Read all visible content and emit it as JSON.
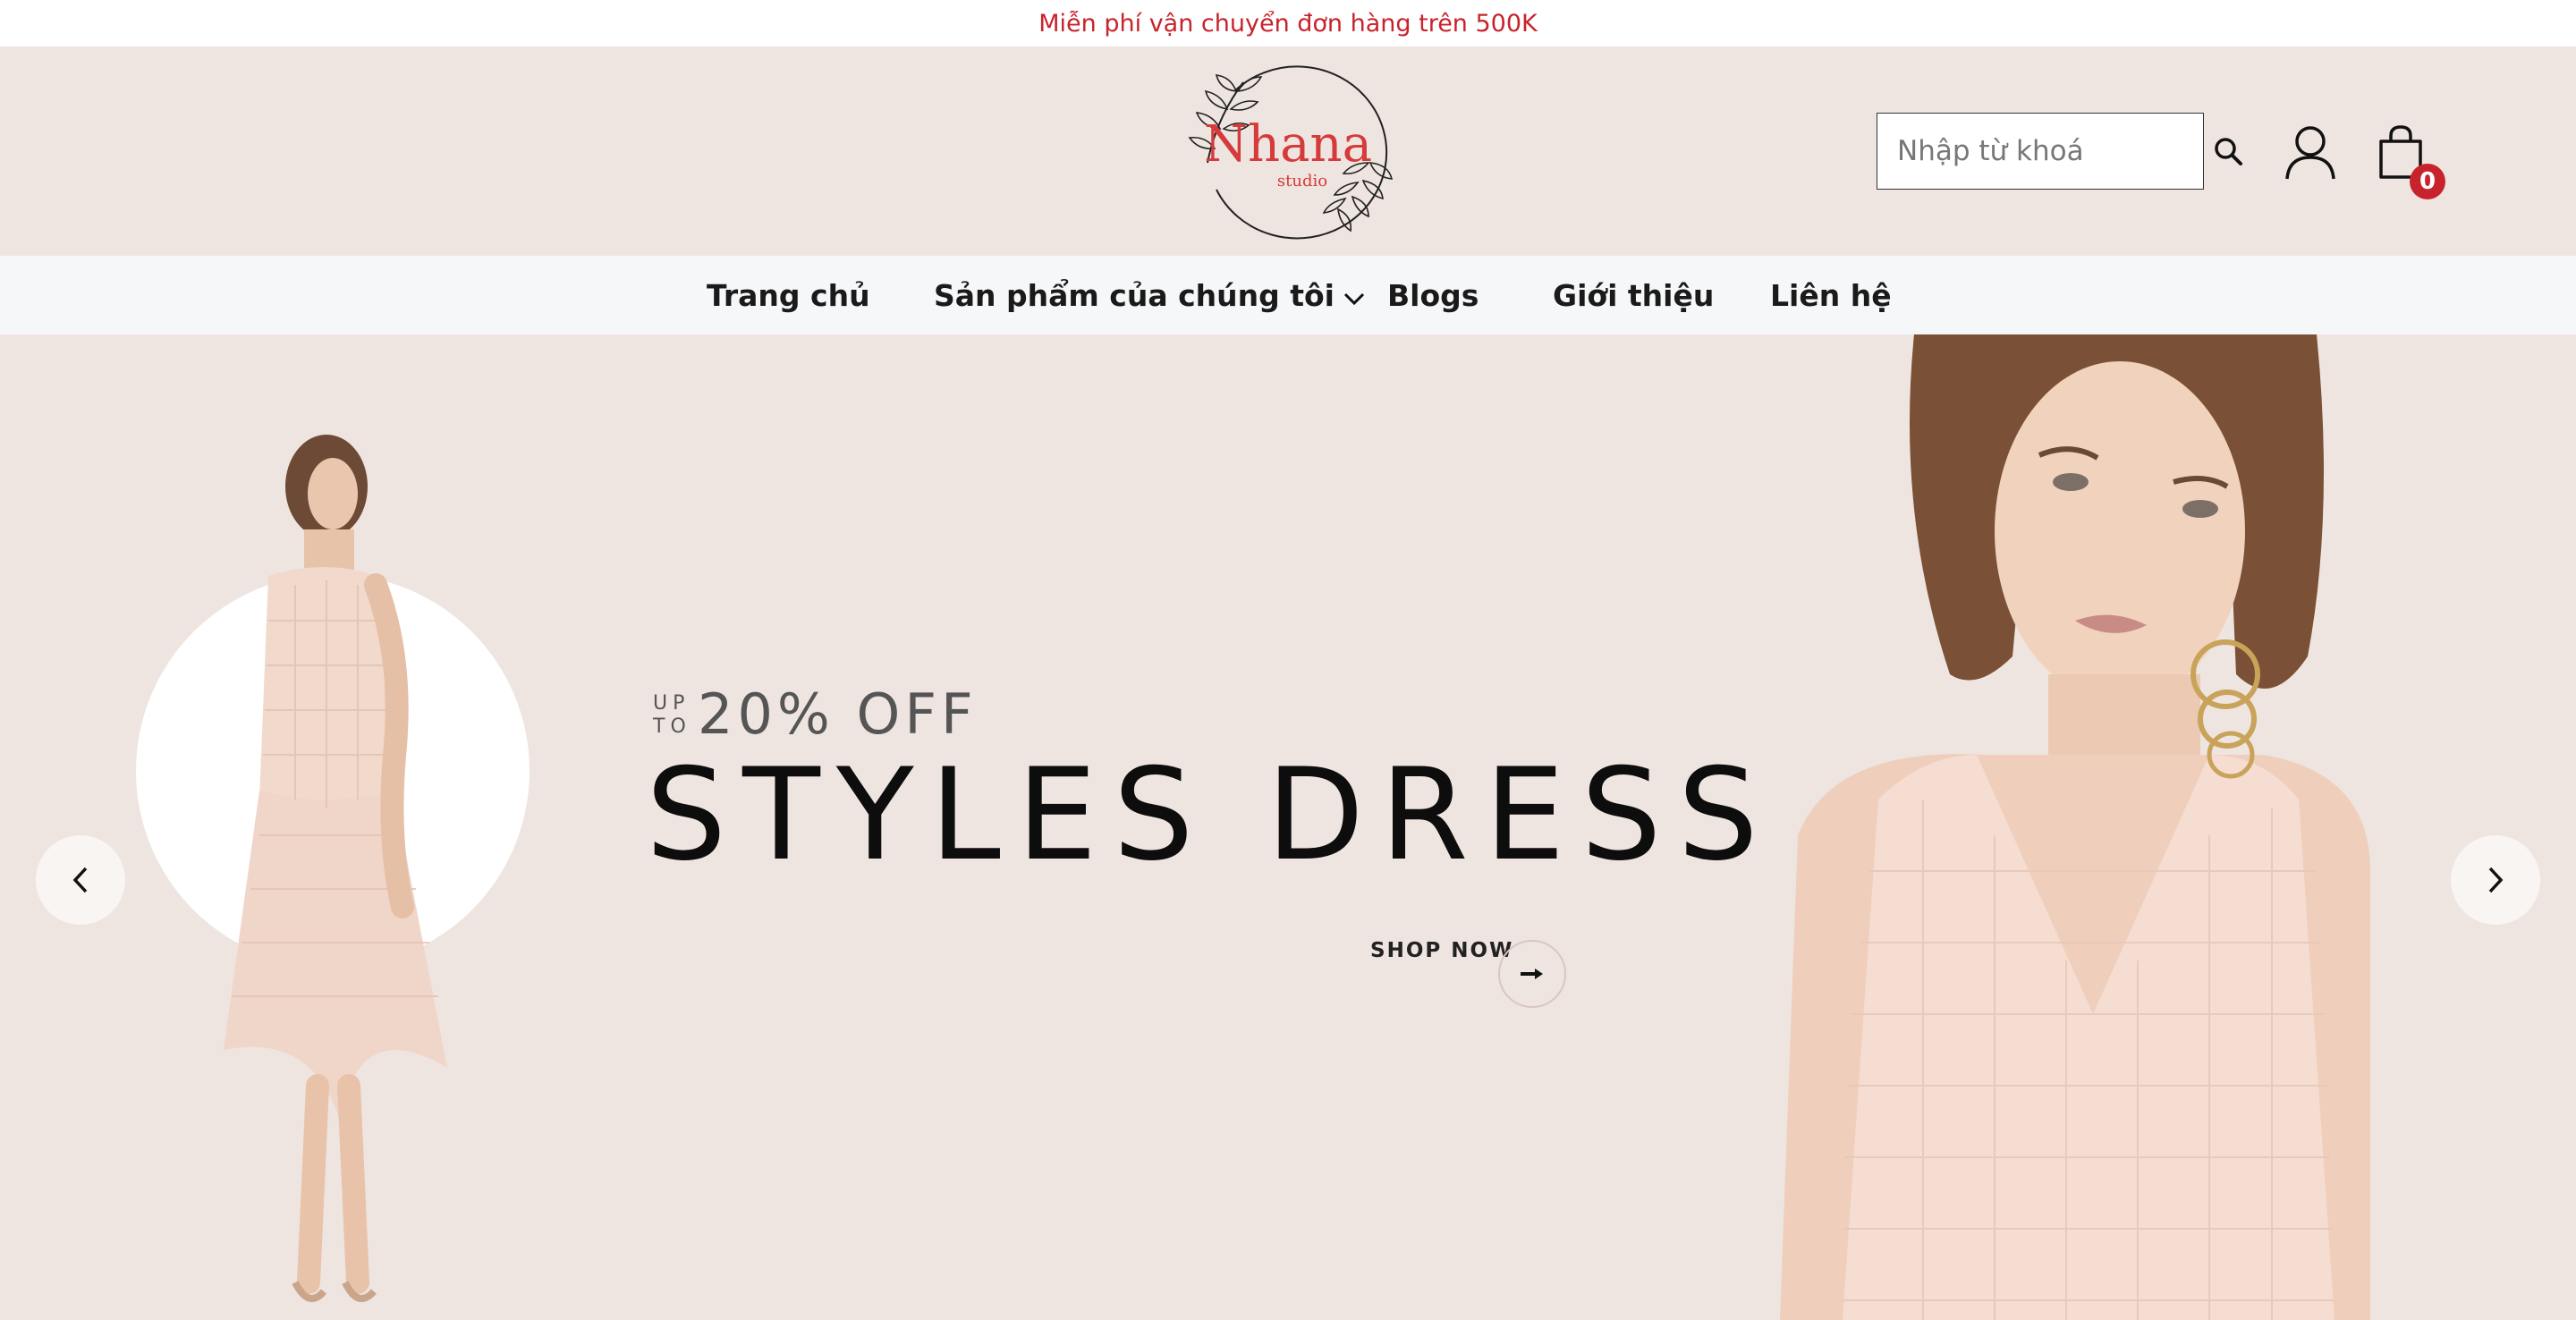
{
  "announcement": {
    "text": "Miễn phí vận chuyển đơn hàng trên 500K"
  },
  "header": {
    "logo": {
      "name": "Nhana",
      "tagline": "studio"
    },
    "search": {
      "placeholder": "Nhập từ khoá",
      "value": ""
    },
    "cart": {
      "count": "0"
    }
  },
  "nav": {
    "items": [
      {
        "label": "Trang chủ"
      },
      {
        "label": "Sản phẩm của chúng tôi"
      },
      {
        "label": "Blogs"
      },
      {
        "label": "Giới thiệu"
      },
      {
        "label": "Liên hệ"
      }
    ]
  },
  "hero": {
    "upto_line1": "UP",
    "upto_line2": "TO",
    "discount": "20% OFF",
    "headline": "STYLES DRESS",
    "cta": "SHOP NOW"
  },
  "colors": {
    "accent": "#c8232c",
    "header_bg": "#eee5e0",
    "nav_bg": "#f6f7f9"
  },
  "icons": [
    "search-icon",
    "user-icon",
    "cart-icon",
    "chevron-down-icon",
    "arrow-right-icon",
    "chevron-left-icon",
    "chevron-right-icon"
  ]
}
